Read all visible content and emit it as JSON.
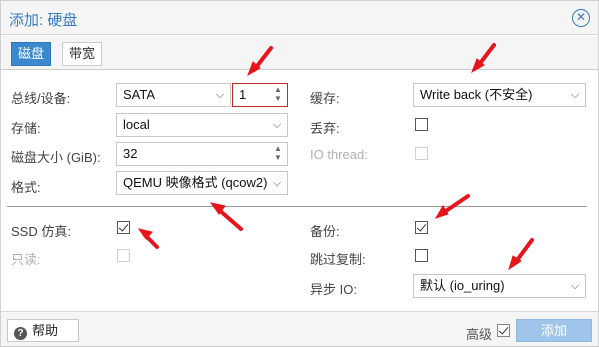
{
  "dialog": {
    "title": "添加: 硬盘"
  },
  "tabs": [
    {
      "label": "磁盘",
      "active": true
    },
    {
      "label": "带宽",
      "active": false
    }
  ],
  "form": {
    "bus_label": "总线/设备:",
    "bus_value": "SATA",
    "device_value": "1",
    "storage_label": "存储:",
    "storage_value": "local",
    "size_label": "磁盘大小 (GiB):",
    "size_value": "32",
    "format_label": "格式:",
    "format_value": "QEMU 映像格式 (qcow2)",
    "cache_label": "缓存:",
    "cache_value": "Write back (不安全)",
    "discard_label": "丢弃:",
    "discard_checked": false,
    "iothread_label": "IO thread:",
    "iothread_checked": false,
    "ssd_label": "SSD 仿真:",
    "ssd_checked": true,
    "readonly_label": "只读:",
    "readonly_checked": false,
    "backup_label": "备份:",
    "backup_checked": true,
    "skip_replication_label": "跳过复制:",
    "skip_replication_checked": false,
    "async_io_label": "异步 IO:",
    "async_io_value": "默认 (io_uring)"
  },
  "footer": {
    "help_label": "帮助",
    "advanced_label": "高级",
    "advanced_checked": true,
    "add_label": "添加"
  },
  "colors": {
    "accent": "#3a88d0",
    "annotation_arrow": "#e8141c"
  },
  "icons": {
    "close": "close-circle-icon",
    "help": "help-circle-icon",
    "dropdown": "chevron-down-icon",
    "spinner": "spinner-up-down-icon"
  }
}
